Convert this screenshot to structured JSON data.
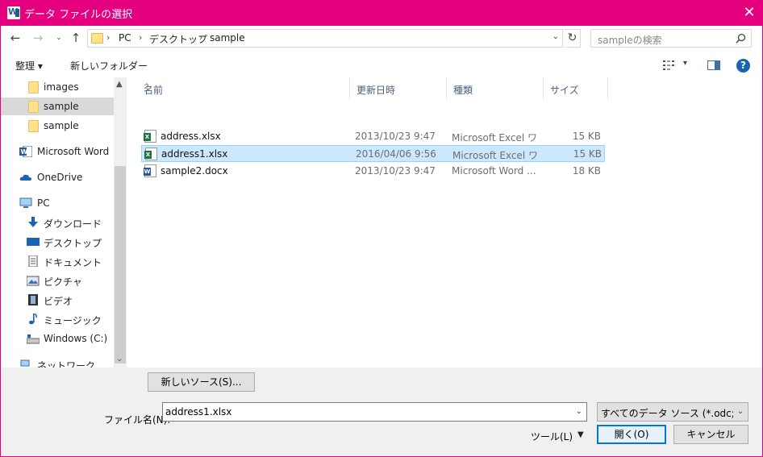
{
  "window": {
    "title": "データ ファイルの選択",
    "close_glyph": "✕"
  },
  "address": {
    "segments": [
      "PC",
      "デスクトップ",
      "sample"
    ],
    "search_placeholder": "sampleの検索"
  },
  "toolbar": {
    "organize": "整理 ▾",
    "new_folder": "新しいフォルダー"
  },
  "nav": {
    "items": [
      {
        "label": "images"
      },
      {
        "label": "sample"
      },
      {
        "label": "sample"
      },
      {
        "label": "Microsoft Word"
      },
      {
        "label": "OneDrive"
      },
      {
        "label": "PC"
      },
      {
        "label": "ダウンロード"
      },
      {
        "label": "デスクトップ"
      },
      {
        "label": "ドキュメント"
      },
      {
        "label": "ピクチャ"
      },
      {
        "label": "ビデオ"
      },
      {
        "label": "ミュージック"
      },
      {
        "label": "Windows (C:)"
      },
      {
        "label": "ネットワーク"
      }
    ]
  },
  "columns": {
    "name": "名前",
    "date": "更新日時",
    "type": "種類",
    "size": "サイズ"
  },
  "files": [
    {
      "name": "address.xlsx",
      "date": "2013/10/23 9:47",
      "type": "Microsoft Excel ワ...",
      "size": "15 KB",
      "kind": "excel"
    },
    {
      "name": "address1.xlsx",
      "date": "2016/04/06 9:56",
      "type": "Microsoft Excel ワ...",
      "size": "15 KB",
      "kind": "excel"
    },
    {
      "name": "sample2.docx",
      "date": "2013/10/23 9:47",
      "type": "Microsoft Word ...",
      "size": "18 KB",
      "kind": "word"
    }
  ],
  "bottom": {
    "new_source": "新しいソース(S)...",
    "filename_label": "ファイル名(N):",
    "filename_value": "address1.xlsx",
    "filter_value": "すべてのデータ ソース (*.odc;*.mdb;",
    "tools": "ツール(L)",
    "open": "開く(O)",
    "cancel": "キャンセル"
  },
  "colors": {
    "titlebar": "#e4007f",
    "selection": "#cce8ff",
    "excel": "#1e7145",
    "word": "#2b5797"
  }
}
